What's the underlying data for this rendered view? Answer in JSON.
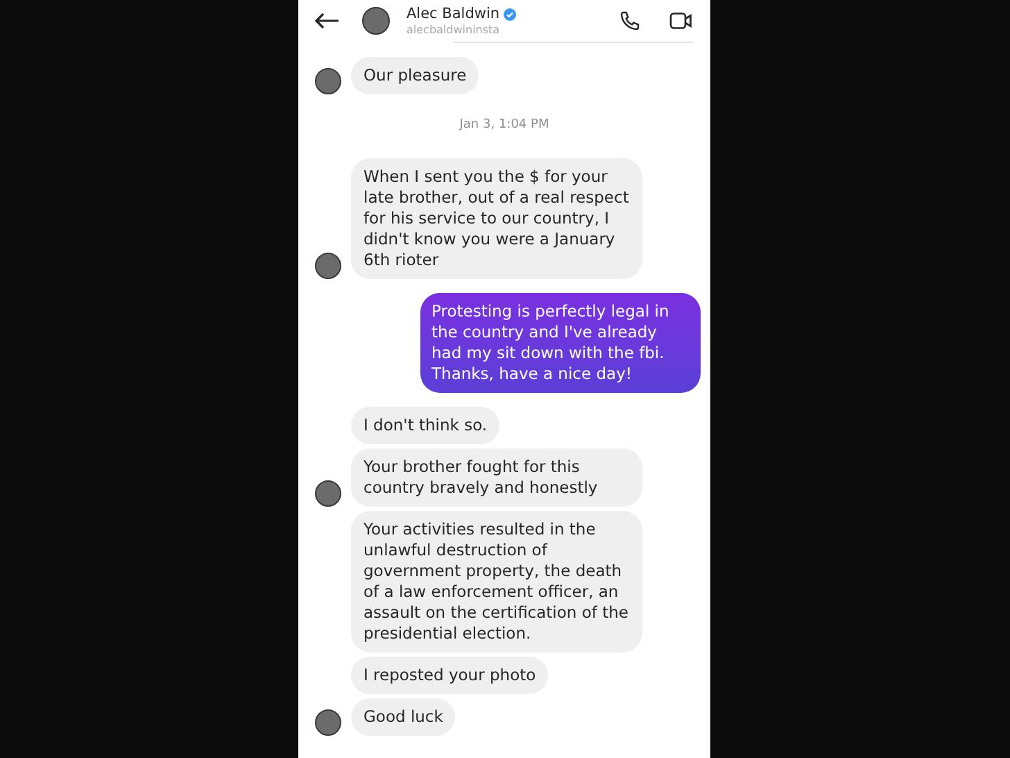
{
  "header": {
    "name": "Alec Baldwin",
    "verified": true,
    "handle": "alecbaldwininsta"
  },
  "messages": [
    {
      "kind": "incoming",
      "text": "Our pleasure",
      "avatar": true
    },
    {
      "kind": "timestamp",
      "text": "Jan 3, 1:04 PM"
    },
    {
      "kind": "incoming",
      "text": "When I sent you the $ for your late brother, out of a real respect for his service to our country, I didn't know you were a January 6th rioter",
      "avatar": true
    },
    {
      "kind": "outgoing",
      "text": "Protesting is perfectly legal in the country and I've already had my sit down with the fbi. Thanks, have a nice day!"
    },
    {
      "kind": "incoming",
      "text": "I don't think so.",
      "avatar": false
    },
    {
      "kind": "incoming",
      "text": "Your brother fought for this country bravely and honestly",
      "avatar": true
    },
    {
      "kind": "incoming",
      "text": "Your activities resulted in the unlawful destruction of government property, the death of a law enforcement officer, an assault on the certification of the presidential election.",
      "avatar": false
    },
    {
      "kind": "incoming",
      "text": "I reposted your photo",
      "avatar": false
    },
    {
      "kind": "incoming",
      "text": "Good luck",
      "avatar": true
    }
  ]
}
